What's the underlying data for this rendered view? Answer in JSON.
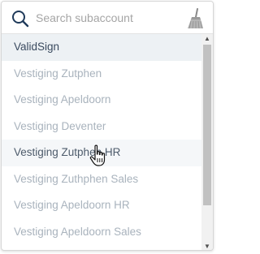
{
  "search": {
    "placeholder": "Search subaccount",
    "value": ""
  },
  "icons": {
    "search": "search-icon",
    "clear": "broom-icon",
    "scroll_up": "chevron-up-icon",
    "scroll_down": "chevron-down-icon",
    "cursor": "hand-pointer-cursor"
  },
  "list": {
    "items": [
      {
        "label": "ValidSign",
        "state": "selected"
      },
      {
        "label": "Vestiging Zutphen",
        "state": "normal"
      },
      {
        "label": "Vestiging Apeldoorn",
        "state": "normal"
      },
      {
        "label": "Vestiging Deventer",
        "state": "normal"
      },
      {
        "label": "Vestiging Zutphen HR",
        "state": "hover"
      },
      {
        "label": "Vestiging Zuthphen Sales",
        "state": "normal"
      },
      {
        "label": "Vestiging Apeldoorn HR",
        "state": "normal"
      },
      {
        "label": "Vestiging Apeldoorn Sales",
        "state": "normal"
      }
    ]
  },
  "scroll": {
    "thumb_fraction_visible": 0.78,
    "thumb_position_fraction": 0.0
  },
  "colors": {
    "selected_text": "#3a4a5f",
    "item_text": "#a9b3bd",
    "search_icon": "#1f3a5a"
  }
}
